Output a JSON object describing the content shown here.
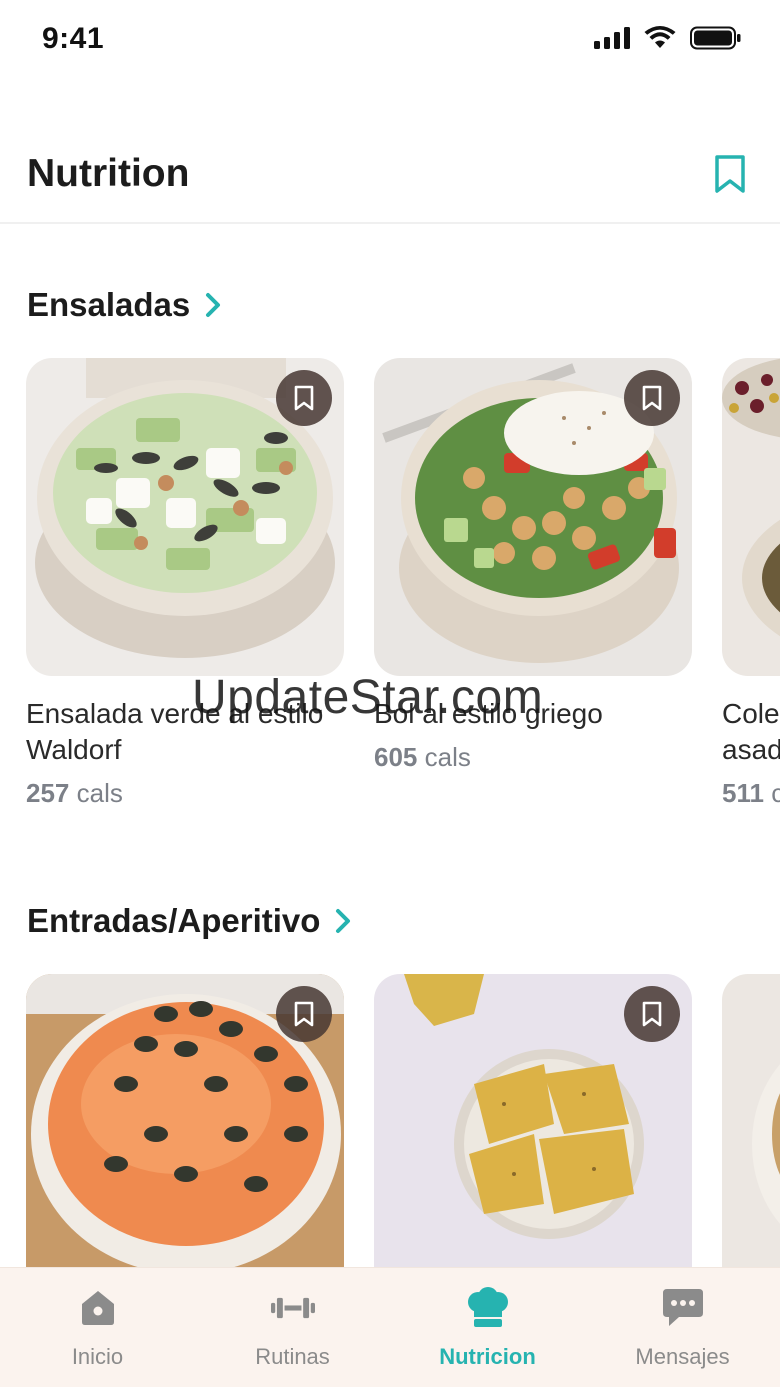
{
  "status_bar": {
    "time": "9:41"
  },
  "header": {
    "title": "Nutrition"
  },
  "sections": [
    {
      "title": "Ensaladas",
      "cards": [
        {
          "title": "Ensalada verde al estilo Waldorf",
          "cals_value": "257",
          "cals_unit": "cals"
        },
        {
          "title": "Bol al estilo griego",
          "cals_value": "605",
          "cals_unit": "cals"
        },
        {
          "title": "Cole asad",
          "cals_value": "511",
          "cals_unit": "c"
        }
      ]
    },
    {
      "title": "Entradas/Aperitivo",
      "cards": []
    }
  ],
  "watermark": "UpdateStar.com",
  "tabs": [
    {
      "label": "Inicio",
      "icon": "home-icon",
      "active": false
    },
    {
      "label": "Rutinas",
      "icon": "dumbbell-icon",
      "active": false
    },
    {
      "label": "Nutricion",
      "icon": "chef-hat-icon",
      "active": true
    },
    {
      "label": "Mensajes",
      "icon": "chat-icon",
      "active": false
    }
  ],
  "colors": {
    "accent": "#26b3b0",
    "tab_bar_bg": "#fbf3ee",
    "muted": "#7c8088"
  }
}
